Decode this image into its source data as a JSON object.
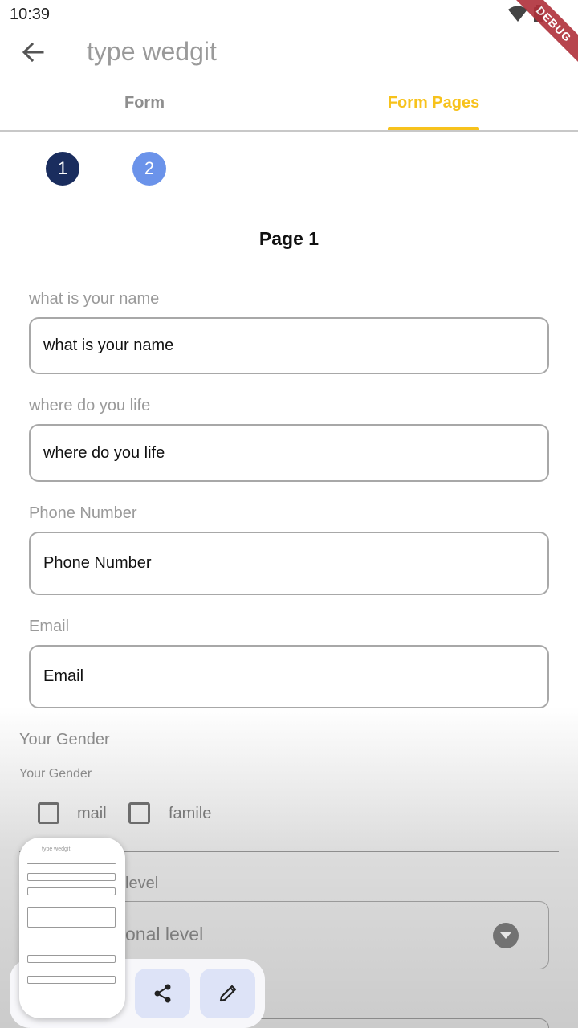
{
  "status_bar": {
    "time": "10:39",
    "debug_label": "DEBUG"
  },
  "app_bar": {
    "title": "type wedgit"
  },
  "tabs": [
    {
      "label": "Form",
      "selected": false
    },
    {
      "label": "Form Pages",
      "selected": true
    }
  ],
  "steps": [
    {
      "label": "1",
      "active": true
    },
    {
      "label": "2",
      "active": false
    }
  ],
  "page": {
    "heading": "Page 1"
  },
  "fields": [
    {
      "label": "what is your name",
      "value": "what is your name"
    },
    {
      "label": "where do you life",
      "value": "where do you life"
    },
    {
      "label": "Phone Number",
      "value": "Phone Number"
    },
    {
      "label": "Email",
      "value": "Email"
    }
  ],
  "gender": {
    "title": "Your Gender",
    "subtitle": "Your Gender",
    "options": [
      "mail",
      "famile"
    ]
  },
  "education": {
    "label_visible": "level",
    "value_visible": "onal level"
  },
  "thumbnail": {
    "title": "type wedgit"
  },
  "colors": {
    "accent": "#f7c21c",
    "step_active": "#1a2d5e",
    "step_inactive": "#6b93ea",
    "tool_button": "#dde3f7"
  },
  "icons": {
    "back": "arrow-left",
    "share": "share",
    "edit": "pencil",
    "dropdown": "caret-down",
    "wifi": "wifi",
    "battery": "battery"
  }
}
